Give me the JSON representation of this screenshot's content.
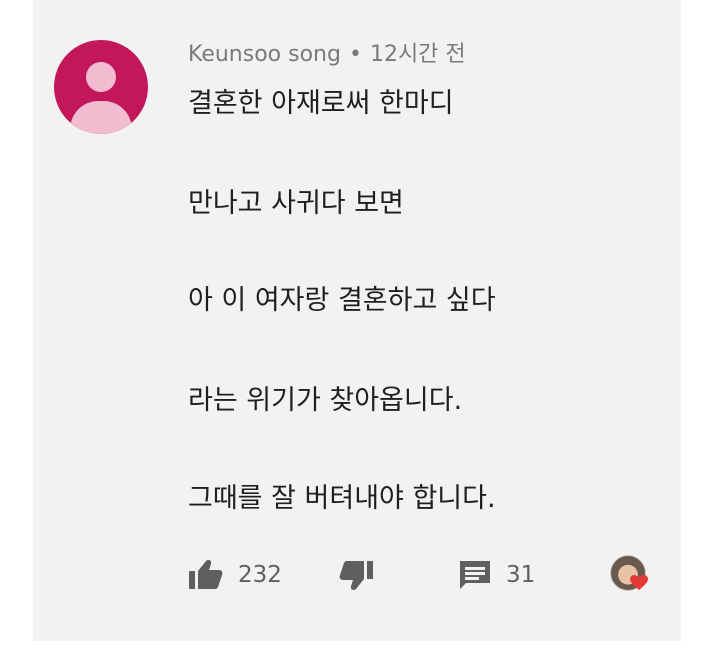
{
  "comment": {
    "author": "Keunsoo song",
    "separator": "•",
    "time": "12시간 전",
    "lines": [
      "결혼한 아재로써 한마디",
      "만나고 사귀다 보면",
      "아 이 여자랑 결혼하고 싶다",
      "라는 위기가 찾아옵니다.",
      "그때를 잘 버텨내야 합니다."
    ],
    "likes": "232",
    "replies": "31"
  },
  "colors": {
    "avatar": "#c2185b",
    "avatar_figure": "#f1bcd0",
    "card_background": "#f2f2f2",
    "heart": "#e53935"
  },
  "icons": {
    "like": "thumbs-up-icon",
    "dislike": "thumbs-down-icon",
    "reply": "comment-icon",
    "creator_heart": "heart-icon"
  }
}
